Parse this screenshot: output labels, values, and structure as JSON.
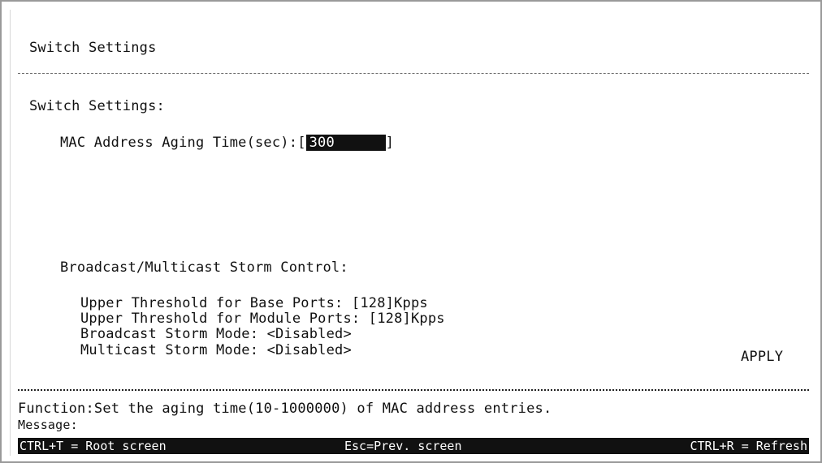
{
  "screen": {
    "title": "Switch Settings",
    "section_label": "Switch Settings:",
    "mac_aging_label": "MAC Address Aging Time(sec):",
    "mac_aging_value": "300",
    "storm_section_label": "Broadcast/Multicast Storm Control:",
    "upper_base_label": "Upper Threshold for Base Ports:",
    "upper_base_value": "[128]Kpps",
    "upper_module_label": "Upper Threshold for Module Ports:",
    "upper_module_value": "[128]Kpps",
    "broadcast_mode_label": "Broadcast Storm Mode:",
    "broadcast_mode_value": "<Disabled>",
    "multicast_mode_label": "Multicast Storm Mode:",
    "multicast_mode_value": "<Disabled>",
    "apply_label": "APPLY"
  },
  "footer": {
    "function_text": "Function:Set the aging time(10-1000000) of MAC address entries.",
    "message_label": "Message:"
  },
  "hotkeys": {
    "root": "CTRL+T = Root screen",
    "prev": "Esc=Prev. screen",
    "refresh": "CTRL+R = Refresh"
  }
}
